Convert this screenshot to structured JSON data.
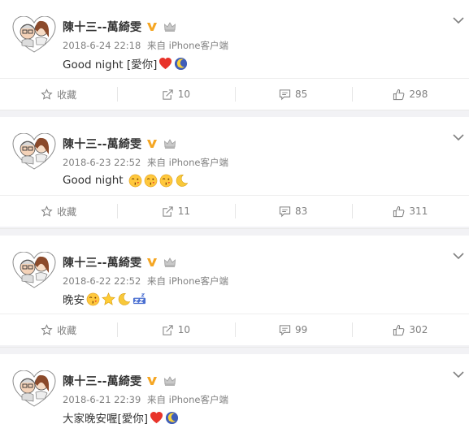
{
  "posts": [
    {
      "author": "陳十三--萬綺雯",
      "timestamp": "2018-6-24 22:18",
      "source": "来自 iPhone客户端",
      "text": "Good night [愛你]",
      "emojis": [
        "heart-emoji",
        "moon-sleep-emoji"
      ],
      "actions": {
        "favorite": "收藏",
        "repost": "10",
        "comment": "85",
        "like": "298"
      }
    },
    {
      "author": "陳十三--萬綺雯",
      "timestamp": "2018-6-23 22:52",
      "source": "来自 iPhone客户端",
      "text": "Good night ",
      "emojis": [
        "kiss-emoji",
        "kiss-emoji",
        "kiss-emoji",
        "crescent-moon-emoji"
      ],
      "actions": {
        "favorite": "收藏",
        "repost": "11",
        "comment": "83",
        "like": "311"
      }
    },
    {
      "author": "陳十三--萬綺雯",
      "timestamp": "2018-6-22 22:52",
      "source": "来自 iPhone客户端",
      "text": "晚安",
      "emojis": [
        "kiss-emoji",
        "star-emoji",
        "crescent-moon-emoji",
        "sleep-zz-emoji"
      ],
      "actions": {
        "favorite": "收藏",
        "repost": "10",
        "comment": "99",
        "like": "302"
      }
    },
    {
      "author": "陳十三--萬綺雯",
      "timestamp": "2018-6-21 22:39",
      "source": "来自 iPhone客户端",
      "text": "大家晚安喔[愛你]",
      "emojis": [
        "heart-emoji",
        "moon-sleep-emoji"
      ]
    }
  ],
  "colors": {
    "badge_gold": "#f5a623",
    "text_primary": "#333333",
    "text_meta": "#808080",
    "heart_red": "#e8332a",
    "divider": "#eeeeee",
    "page_bg": "#f2f2f5"
  },
  "icons": {
    "verified": "v-badge-icon",
    "member": "crown-icon",
    "menu": "chevron-down-icon",
    "favorite": "star-outline-icon",
    "repost": "repost-icon",
    "comment": "comment-icon",
    "like": "thumbs-up-icon"
  }
}
